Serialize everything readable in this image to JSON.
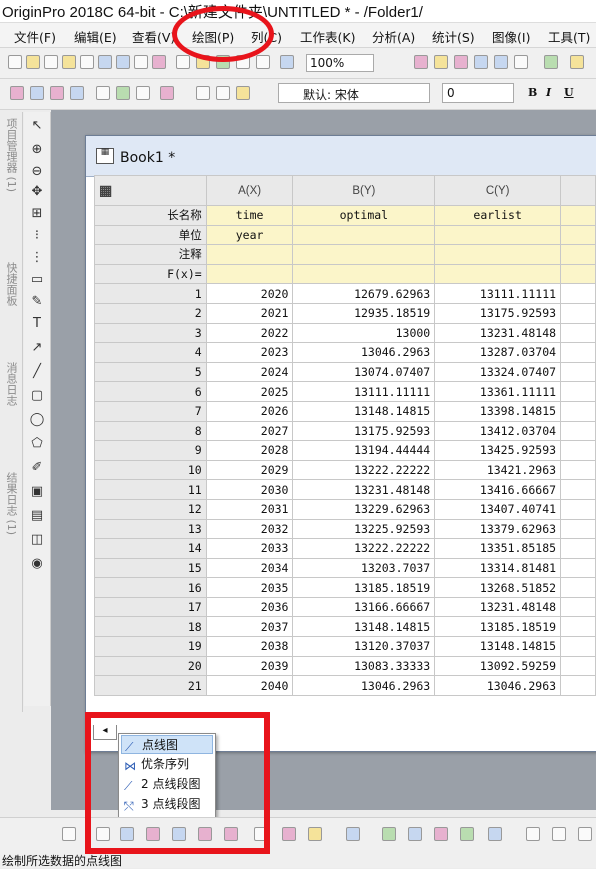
{
  "window": {
    "title": "OriginPro 2018C 64-bit - C:\\新建文件夹\\UNTITLED * - /Folder1/"
  },
  "menu": [
    "文件(F)",
    "编辑(E)",
    "查看(V)",
    "绘图(P)",
    "列(C)",
    "工作表(K)",
    "分析(A)",
    "统计(S)",
    "图像(I)",
    "工具(T)"
  ],
  "toolbar": {
    "zoom": "100%",
    "font": "默认: 宋体",
    "font_size": "0",
    "bold": "B",
    "italic": "I",
    "underline": "U"
  },
  "left_panel": {
    "label_top": "项目管理器 (1)",
    "label_mid": "快捷面板",
    "label_low": "消息日志",
    "label_bottom": "结果日志 (1)"
  },
  "book": {
    "title": "Book1 *",
    "columns": [
      "A(X)",
      "B(Y)",
      "C(Y)"
    ],
    "meta_rows": [
      {
        "label": "长名称",
        "values": [
          "time",
          "optimal",
          "earlist"
        ]
      },
      {
        "label": "单位",
        "values": [
          "year",
          "",
          ""
        ]
      },
      {
        "label": "注释",
        "values": [
          "",
          "",
          ""
        ]
      },
      {
        "label": "F(x)=",
        "values": [
          "",
          "",
          ""
        ]
      }
    ],
    "rows": [
      [
        "1",
        "2020",
        "12679.62963",
        "13111.11111"
      ],
      [
        "2",
        "2021",
        "12935.18519",
        "13175.92593"
      ],
      [
        "3",
        "2022",
        "13000",
        "13231.48148"
      ],
      [
        "4",
        "2023",
        "13046.2963",
        "13287.03704"
      ],
      [
        "5",
        "2024",
        "13074.07407",
        "13324.07407"
      ],
      [
        "6",
        "2025",
        "13111.11111",
        "13361.11111"
      ],
      [
        "7",
        "2026",
        "13148.14815",
        "13398.14815"
      ],
      [
        "8",
        "2027",
        "13175.92593",
        "13412.03704"
      ],
      [
        "9",
        "2028",
        "13194.44444",
        "13425.92593"
      ],
      [
        "10",
        "2029",
        "13222.22222",
        "13421.2963"
      ],
      [
        "11",
        "2030",
        "13231.48148",
        "13416.66667"
      ],
      [
        "12",
        "2031",
        "13229.62963",
        "13407.40741"
      ],
      [
        "13",
        "2032",
        "13225.92593",
        "13379.62963"
      ],
      [
        "14",
        "2033",
        "13222.22222",
        "13351.85185"
      ],
      [
        "15",
        "2034",
        "13203.7037",
        "13314.81481"
      ],
      [
        "16",
        "2035",
        "13185.18519",
        "13268.51852"
      ],
      [
        "17",
        "2036",
        "13166.66667",
        "13231.48148"
      ],
      [
        "18",
        "2037",
        "13148.14815",
        "13185.18519"
      ],
      [
        "19",
        "2038",
        "13120.37037",
        "13148.14815"
      ],
      [
        "20",
        "2039",
        "13083.33333",
        "13092.59259"
      ],
      [
        "21",
        "2040",
        "13046.2963",
        "13046.2963"
      ]
    ]
  },
  "popup_menu": [
    "点线图",
    "优条序列",
    "2 点线段图",
    "3 点线段图"
  ],
  "status": {
    "text": "绘制所选数据的点线图"
  },
  "colors": {
    "highlight": "#e8141b",
    "meta_fill": "#fbf5c9",
    "workspace": "#9aa0a8"
  }
}
